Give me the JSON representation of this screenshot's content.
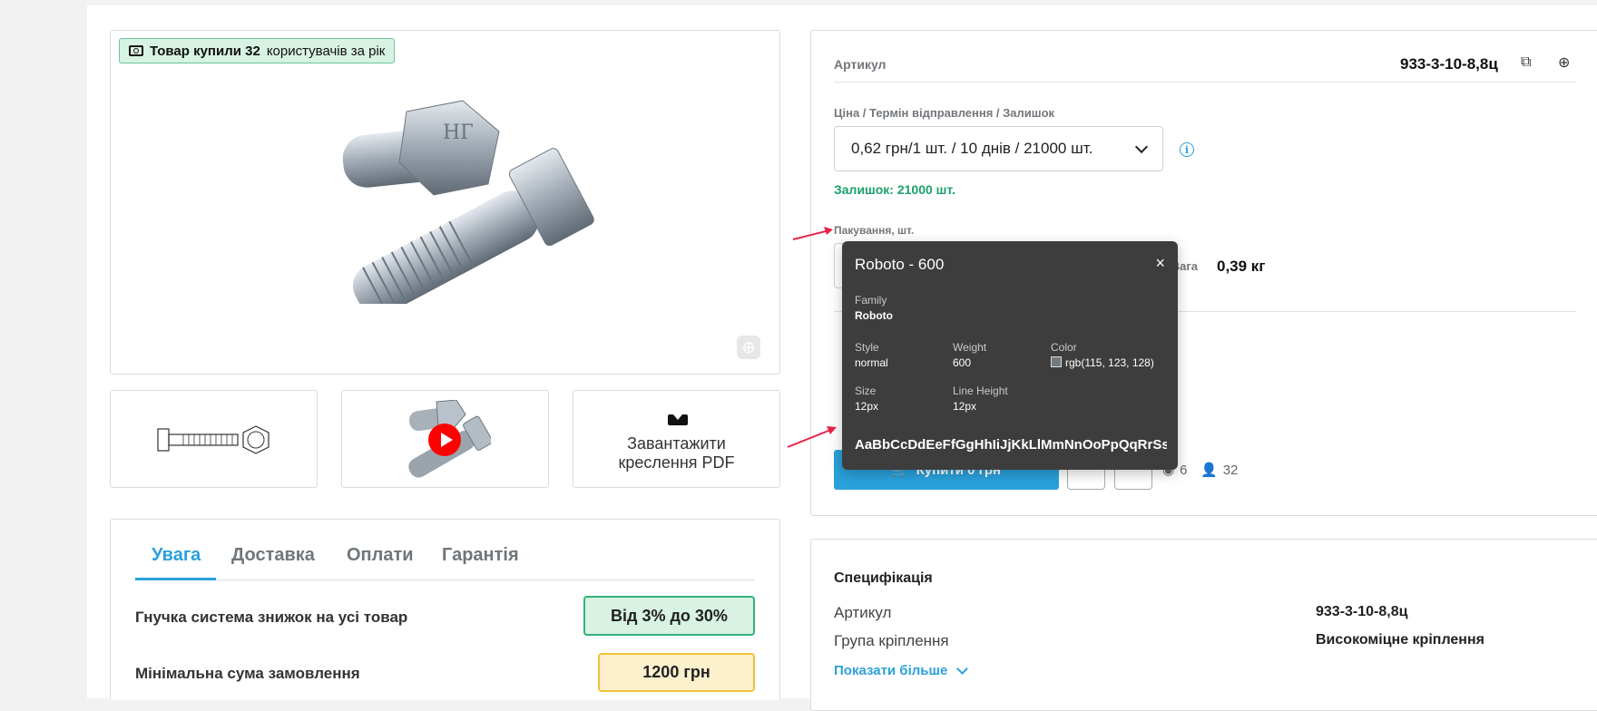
{
  "product": {
    "badge_prefix": "Товар купили 32",
    "badge_suffix": "користувачів за рік",
    "download_label_line1": "Завантажити",
    "download_label_line2": "креслення PDF"
  },
  "tabs": [
    {
      "label": "Увага",
      "active": true
    },
    {
      "label": "Доставка",
      "active": false
    },
    {
      "label": "Оплати",
      "active": false
    },
    {
      "label": "Гарантія",
      "active": false
    }
  ],
  "info_rows": [
    {
      "label": "Гнучка система знижок на усі товар",
      "value": "Від 3% до 30%",
      "bg": "#d8f2e3",
      "border": "#31b27a"
    },
    {
      "label": "Мінімальна сума замовлення",
      "value": "1200 грн",
      "bg": "#fdf0cd",
      "border": "#f1c23a"
    }
  ],
  "order_panel": {
    "sku_label": "Артикул",
    "sku_value": "933-3-10-8,8ц",
    "price_label": "Ціна / Термін відправлення / Залишок",
    "price_select_value": "0,62 грн/1 шт. / 10 днів / 21000 шт.",
    "stock_text": "Залишок: 21000 шт.",
    "packaging_label": "Пакування, шт.",
    "weight_label": "Вага",
    "weight_value": "0,39 кг",
    "buy_label": "Купити 0 грн",
    "views_count": "6",
    "buyers_count": "32",
    "colors": {
      "accent": "#2aa1db",
      "stock_green": "#1aa06a"
    }
  },
  "spec": {
    "title": "Специфікація",
    "rows": [
      {
        "key": "Артикул",
        "value": "933-3-10-8,8ц"
      },
      {
        "key": "Група кріплення",
        "value": "Високоміцне кріплення"
      }
    ],
    "more_link": "Показати більше"
  },
  "font_tooltip": {
    "title": "Roboto - 600",
    "family_label": "Family",
    "family_value": "Roboto",
    "style_label": "Style",
    "style_value": "normal",
    "weight_label": "Weight",
    "weight_value": "600",
    "color_label": "Color",
    "color_value": "rgb(115, 123, 128)",
    "size_label": "Size",
    "size_value": "12px",
    "line_height_label": "Line Height",
    "line_height_value": "12px",
    "sample": "AaBbCcDdEeFfGgHhIiJjKkLlMmNnOoPpQqRrSsTtUuVvWwXxYyZz",
    "close_icon": "×"
  }
}
